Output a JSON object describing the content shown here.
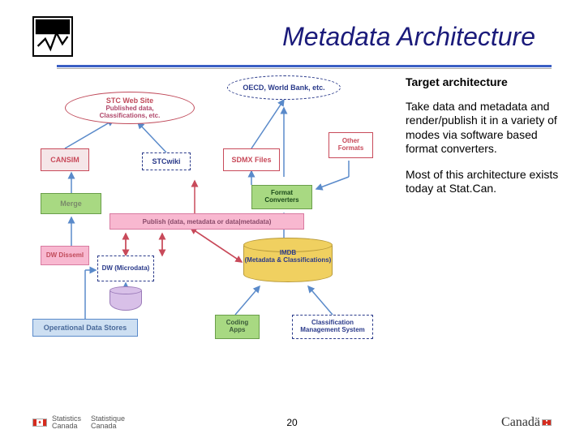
{
  "header": {
    "title": "Metadata Architecture"
  },
  "diagram": {
    "cloud_stc": "STC Web Site",
    "cloud_stc_sub": "Published data,\nClassifications, etc.",
    "cloud_oecd": "OECD, World Bank, etc.",
    "cansim": "CANSIM",
    "stcwiki": "STCwiki",
    "sdmx": "SDMX Files",
    "other_formats": "Other Formats",
    "merge": "Merge",
    "converters": "Format Converters",
    "publish": "Publish (data, metadata or data|metadata)",
    "dw_dissem": "DW Disseml",
    "dw_micro": "DW (Microdata)",
    "imdb_title": "IMDB",
    "imdb_sub": "(Metadata & Classifications)",
    "ods": "Operational Data Stores",
    "coding": "Coding Apps",
    "classif_mgmt": "Classification Management System"
  },
  "sidebar": {
    "heading": "Target architecture",
    "p1": "Take data and metadata and render/publish it in a variety of modes via software based format converters.",
    "p2": "Most of this architecture exists today at Stat.Can."
  },
  "footer": {
    "stat_en": "Statistics",
    "stat_en2": "Canada",
    "stat_fr": "Statistique",
    "stat_fr2": "Canada",
    "page": "20",
    "wordmark": "Canadä"
  }
}
